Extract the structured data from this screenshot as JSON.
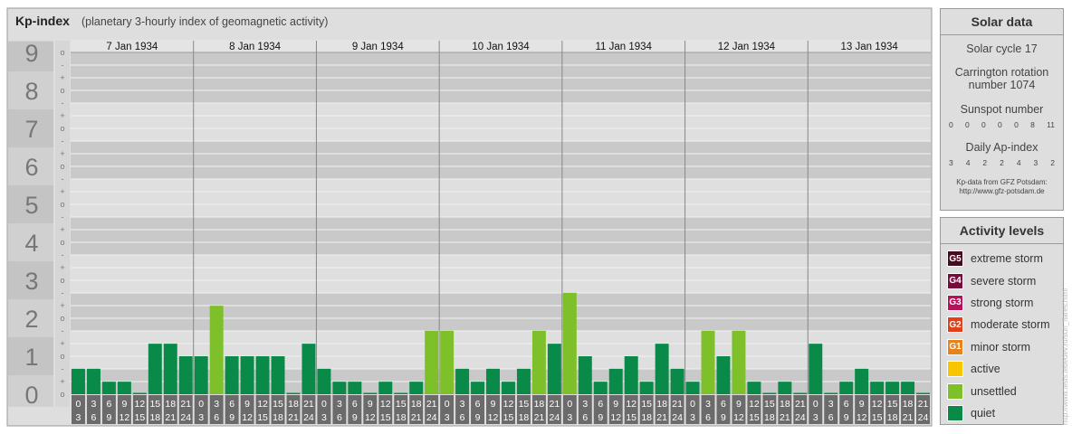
{
  "header": {
    "title": "Kp-index",
    "subtitle": "(planetary 3-hourly index of geomagnetic activity)"
  },
  "chart_data": {
    "type": "bar",
    "ylim": [
      0,
      9
    ],
    "y_ticks": [
      "0",
      "1",
      "2",
      "3",
      "4",
      "5",
      "6",
      "7",
      "8",
      "9"
    ],
    "minor_ticks": [
      "o",
      "+",
      "-",
      "o",
      "+",
      "-",
      "o",
      "+",
      "-",
      "o",
      "+",
      "-",
      "o",
      "+",
      "-",
      "o",
      "+",
      "-",
      "o",
      "+",
      "-",
      "o",
      "+",
      "-",
      "o",
      "+",
      "-",
      "o"
    ],
    "days": [
      "7 Jan 1934",
      "8 Jan 1934",
      "9 Jan 1934",
      "10 Jan 1934",
      "11 Jan 1934",
      "12 Jan 1934",
      "13 Jan 1934"
    ],
    "hour_starts": [
      "0",
      "3",
      "6",
      "9",
      "12",
      "15",
      "18",
      "21"
    ],
    "hour_ends": [
      "3",
      "6",
      "9",
      "12",
      "15",
      "18",
      "21",
      "24"
    ],
    "values": [
      0.67,
      0.67,
      0.33,
      0.33,
      0,
      1.33,
      1.33,
      1,
      1,
      2.33,
      1,
      1,
      1,
      1,
      0,
      1.33,
      0.67,
      0.33,
      0.33,
      0,
      0.33,
      0,
      0.33,
      1.67,
      1.67,
      0.67,
      0.33,
      0.67,
      0.33,
      0.67,
      1.67,
      1.33,
      2.67,
      1,
      0.33,
      0.67,
      1,
      0.33,
      1.33,
      0.67,
      0.33,
      1.67,
      1,
      1.67,
      0.33,
      0,
      0.33,
      0,
      1.33,
      0,
      0.33,
      0.67,
      0.33,
      0.33,
      0.33,
      0
    ],
    "colors": {
      "quiet": "#0a8a48",
      "unsettled": "#7dc02a"
    }
  },
  "solar": {
    "title": "Solar data",
    "cycle": "Solar cycle 17",
    "carrington_1": "Carrington rotation",
    "carrington_2": "number 1074",
    "sunspot_label": "Sunspot number",
    "sunspots": [
      "0",
      "0",
      "0",
      "0",
      "0",
      "8",
      "11"
    ],
    "ap_label": "Daily Ap-index",
    "ap": [
      "3",
      "4",
      "2",
      "2",
      "4",
      "3",
      "2"
    ],
    "credit_1": "Kp-data from GFZ Potsdam:",
    "credit_2": "http://www.gfz-potsdam.de"
  },
  "levels": {
    "title": "Activity levels",
    "items": [
      {
        "badge": "G5",
        "label": "extreme storm",
        "color": "#4a0a24"
      },
      {
        "badge": "G4",
        "label": "severe storm",
        "color": "#7a0a3c"
      },
      {
        "badge": "G3",
        "label": "strong storm",
        "color": "#b8105a"
      },
      {
        "badge": "G2",
        "label": "moderate storm",
        "color": "#e0401a"
      },
      {
        "badge": "G1",
        "label": "minor storm",
        "color": "#e8821a"
      },
      {
        "badge": "",
        "label": "active",
        "color": "#f7c600"
      },
      {
        "badge": "",
        "label": "unsettled",
        "color": "#7dc02a"
      },
      {
        "badge": "",
        "label": "quiet",
        "color": "#0a8a48"
      }
    ]
  },
  "side_url": "http://www.tesis.lebedev.ru/sun_flares.html"
}
